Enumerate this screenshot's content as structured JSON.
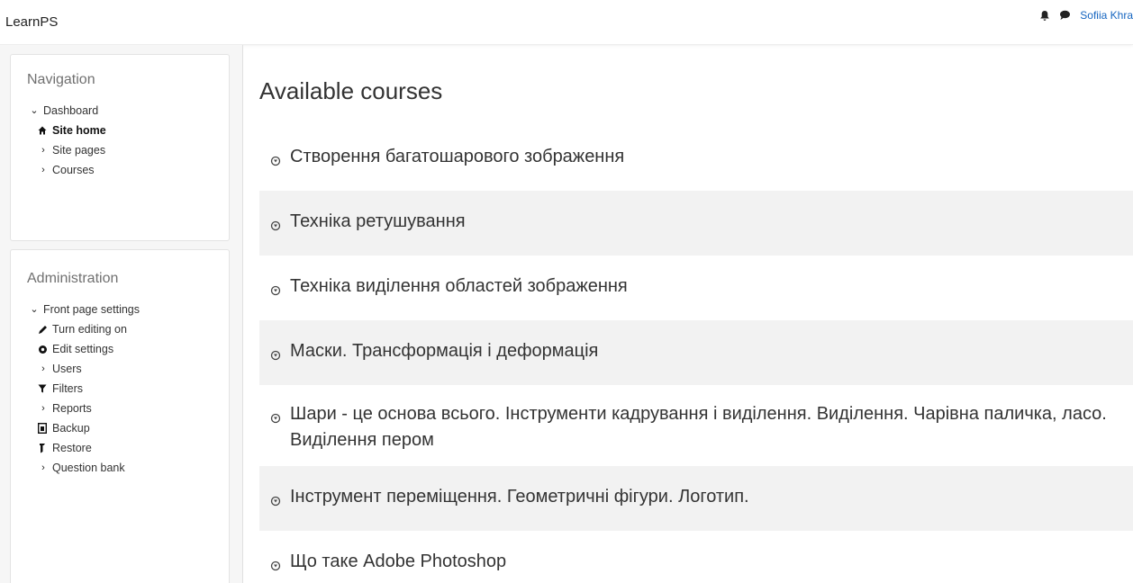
{
  "header": {
    "brand": "LearnPS",
    "user_name": "Sofiia Khra"
  },
  "navigation": {
    "title": "Navigation",
    "items": [
      {
        "label": "Dashboard"
      },
      {
        "label": "Site home"
      },
      {
        "label": "Site pages"
      },
      {
        "label": "Courses"
      }
    ]
  },
  "administration": {
    "title": "Administration",
    "items": [
      {
        "label": "Front page settings"
      },
      {
        "label": "Turn editing on"
      },
      {
        "label": "Edit settings"
      },
      {
        "label": "Users"
      },
      {
        "label": "Filters"
      },
      {
        "label": "Reports"
      },
      {
        "label": "Backup"
      },
      {
        "label": "Restore"
      },
      {
        "label": "Question bank"
      }
    ]
  },
  "main": {
    "title": "Available courses",
    "courses": [
      {
        "name": "Створення багатошарового зображення"
      },
      {
        "name": "Техніка ретушування"
      },
      {
        "name": "Техніка виділення областей зображення"
      },
      {
        "name": "Маски. Трансформація і деформація"
      },
      {
        "name": "Шари - це основа всього. Інструменти кадрування і виділення. Виділення. Чарівна паличка, ласо. Виділення пером"
      },
      {
        "name": "Інструмент переміщення. Геометричні фігури. Логотип."
      },
      {
        "name": "Що таке Adobe Photoshop"
      }
    ]
  },
  "colors": {
    "link": "#1565c0",
    "shaded_row": "#f2f2f2",
    "sidebar_bg": "#f6f6f6"
  }
}
